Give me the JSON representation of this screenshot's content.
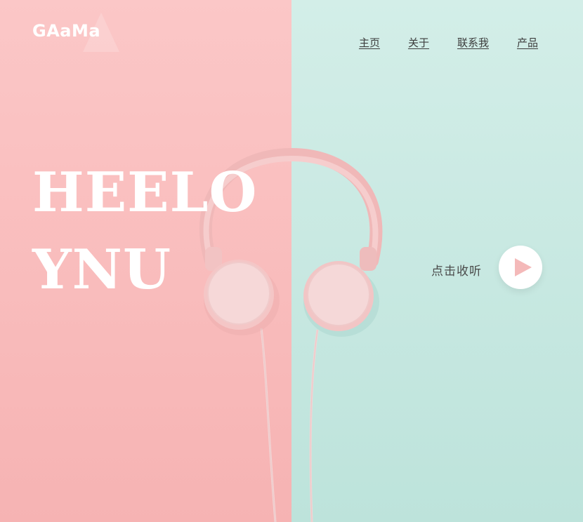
{
  "brand": {
    "logo": "GAaMa"
  },
  "nav": {
    "items": [
      {
        "label": "主页"
      },
      {
        "label": "关于"
      },
      {
        "label": "联系我"
      },
      {
        "label": "产品"
      }
    ]
  },
  "hero": {
    "line1": "HEELO",
    "line2": "YNU"
  },
  "listen": {
    "label": "点击收听",
    "icon": "play-icon"
  },
  "colors": {
    "left_background": "#f9bcbc",
    "right_background": "#c7e8e1",
    "headphone_pink": "#f4cfcf",
    "play_triangle": "#f4b9b9",
    "nav_text": "#3d3d3d",
    "hero_text": "#ffffff"
  }
}
